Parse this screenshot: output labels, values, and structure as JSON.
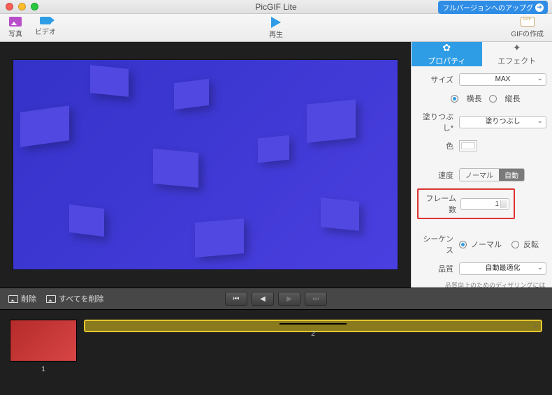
{
  "titlebar": {
    "title": "PicGIF Lite",
    "upgrade_label": "フルバージョンへのアップグ"
  },
  "toolbar": {
    "photo_label": "写真",
    "video_label": "ビデオ",
    "play_label": "再生",
    "create_label": "GIFの作成"
  },
  "sidebar": {
    "tabs": {
      "property": "プロパティ",
      "effect": "エフェクト"
    },
    "size_label": "サイズ",
    "size_value": "MAX",
    "orient_h": "横長",
    "orient_v": "縦長",
    "fill_label": "塗りつぶし*",
    "fill_value": "塗りつぶし",
    "color_label": "色",
    "speed_label": "速度",
    "speed_normal": "ノーマル",
    "speed_auto": "自動",
    "frames_label": "フレーム数",
    "frames_value": "1",
    "sequence_label": "シーケンス",
    "seq_normal": "ノーマル",
    "seq_reverse": "反転",
    "quality_label": "品質",
    "quality_value": "自動最適化",
    "quality_note": "品質向上のためのディザリングには時間がかかります。"
  },
  "ctrlbar": {
    "delete": "削除",
    "delete_all": "すべてを削除"
  },
  "thumbs": {
    "n1": "1",
    "n2": "2"
  }
}
